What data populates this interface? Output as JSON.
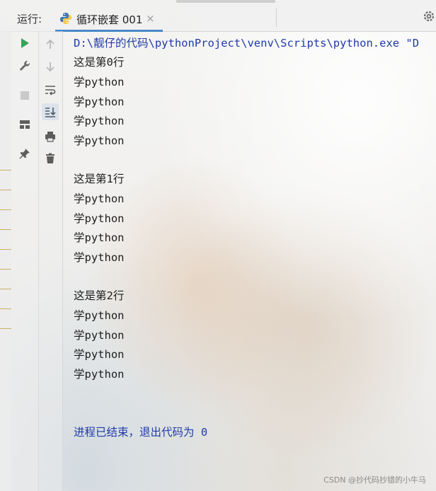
{
  "toolbar": {
    "run_label": "运行:",
    "tab_title": "循环嵌套 001",
    "tab_close": "×"
  },
  "console": {
    "command_line": "D:\\靓仔的代码\\pythonProject\\venv\\Scripts\\python.exe \"D",
    "lines": [
      "这是第0行",
      "学python",
      "学python",
      "学python",
      "学python",
      "",
      "这是第1行",
      "学python",
      "学python",
      "学python",
      "学python",
      "",
      "这是第2行",
      "学python",
      "学python",
      "学python",
      "学python"
    ],
    "exit_message": "进程已结束，退出代码为 0"
  },
  "watermark": "CSDN @抄代码抄错的小牛马",
  "colors": {
    "command": "#1f3aa8",
    "run_green": "#3aa357",
    "tab_underline": "#4a88c7"
  },
  "icons": [
    "python-icon",
    "close-icon",
    "gear-icon",
    "run-icon",
    "wrench-icon",
    "stop-icon",
    "layout-icon",
    "pin-icon",
    "up-arrow-icon",
    "down-arrow-icon",
    "soft-wrap-icon",
    "scroll-to-end-icon",
    "print-icon",
    "trash-icon"
  ]
}
